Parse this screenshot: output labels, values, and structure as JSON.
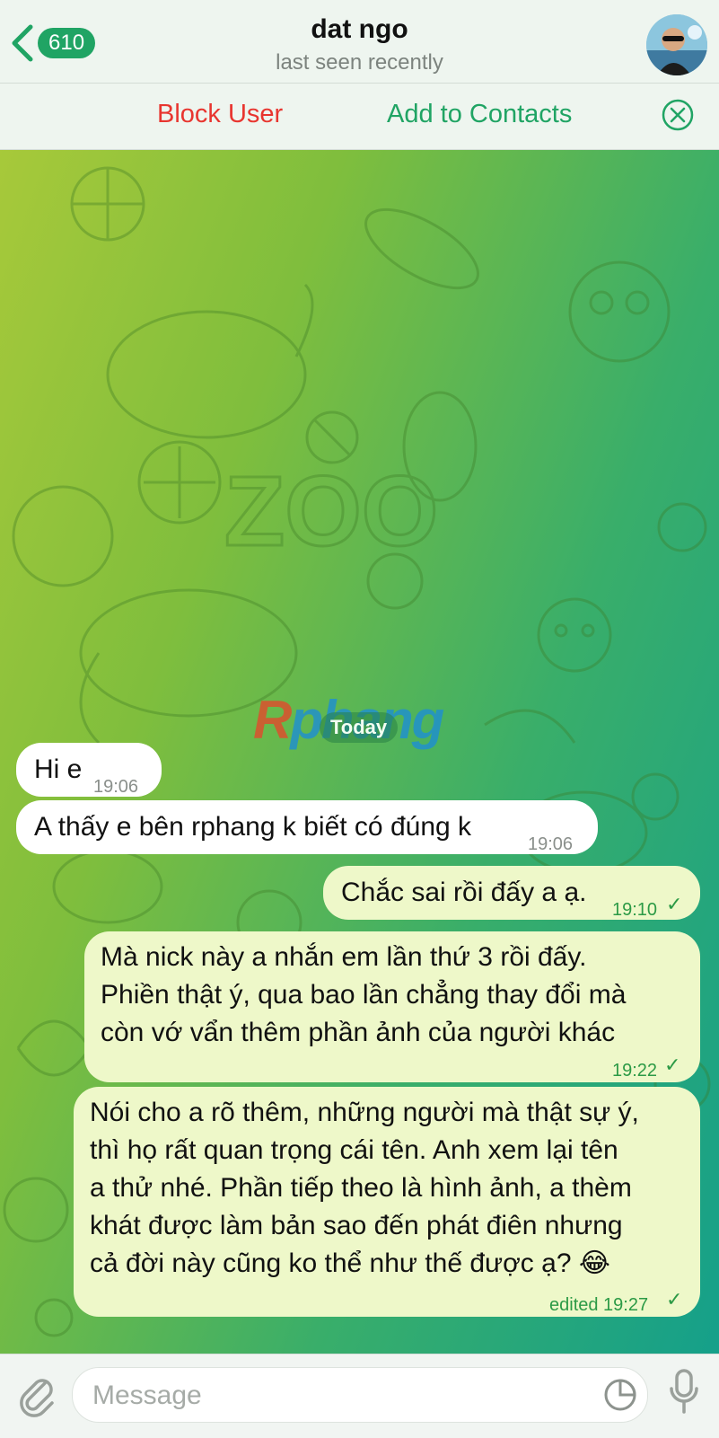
{
  "header": {
    "back_count": "610",
    "name": "dat ngo",
    "status": "last seen recently"
  },
  "actions": {
    "block": "Block User",
    "add": "Add to Contacts"
  },
  "chat": {
    "watermark_a": "R",
    "watermark_b": "phang",
    "date": "Today",
    "messages": [
      {
        "dir": "in",
        "text": "Hi e",
        "time": "19:06"
      },
      {
        "dir": "in",
        "text": "A thấy e bên rphang k biết có đúng k",
        "time": "19:06"
      },
      {
        "dir": "out",
        "text": "Chắc sai rồi đấy a ạ.",
        "time": "19:10"
      },
      {
        "dir": "out",
        "lines": [
          "Mà nick này a nhắn em lần thứ 3 rồi đấy.",
          "Phiền thật ý, qua bao lần chẳng thay đổi mà",
          "còn vớ vẩn thêm phần ảnh của người khác"
        ],
        "time": "19:22"
      },
      {
        "dir": "out",
        "lines": [
          "Nói cho a rõ thêm, những người mà thật sự ý,",
          "thì họ rất quan trọng cái tên. Anh xem lại tên",
          "a thử nhé. Phần tiếp theo là hình ảnh, a thèm",
          "khát được làm bản sao đến phát điên nhưng",
          "cả đời này cũng ko thể như thế được ạ? 😂"
        ],
        "time": "edited 19:27"
      }
    ]
  },
  "input": {
    "placeholder": "Message"
  },
  "colors": {
    "accent": "#20a464",
    "danger": "#e8352f",
    "out_bubble": "#eef8c9"
  }
}
